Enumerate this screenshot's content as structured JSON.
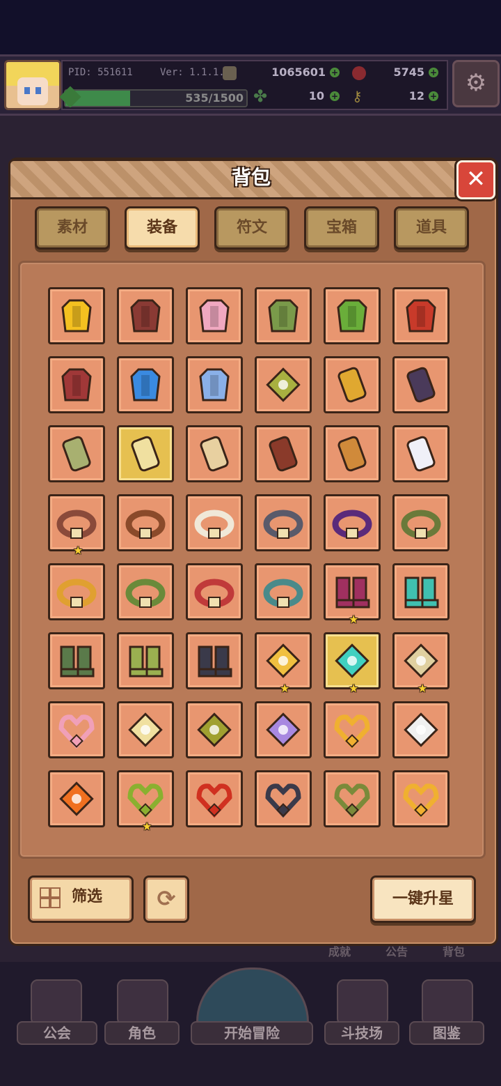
{
  "player": {
    "pid": "PID: 551611",
    "version": "Ver: 1.1.1.2",
    "gold": "1065601",
    "gems": "5745",
    "clover": "10",
    "keys": "12",
    "xp_text": "535/1500",
    "xp_progress": 0.357
  },
  "dialog": {
    "title": "背包",
    "close": "✕",
    "tabs": [
      {
        "label": "素材",
        "active": false
      },
      {
        "label": "装备",
        "active": true
      },
      {
        "label": "符文",
        "active": false
      },
      {
        "label": "宝箱",
        "active": false
      },
      {
        "label": "道具",
        "active": false
      }
    ],
    "filter_label": "筛选",
    "refresh_icon": "refresh-icon",
    "star_up_label": "一键升星"
  },
  "inventory": [
    {
      "icon": "gold-helmet",
      "color": "#f4c020",
      "starred": false,
      "gold_bg": false
    },
    {
      "icon": "dark-hood",
      "color": "#8a3a34",
      "starred": false,
      "gold_bg": false
    },
    {
      "icon": "pink-robe",
      "color": "#f0a8c0",
      "starred": false,
      "gold_bg": false
    },
    {
      "icon": "green-armor",
      "color": "#7a9a4a",
      "starred": false,
      "gold_bg": false
    },
    {
      "icon": "jade-armor",
      "color": "#6aae3a",
      "starred": false,
      "gold_bg": false
    },
    {
      "icon": "crimson-armor",
      "color": "#c83a2a",
      "starred": false,
      "gold_bg": false
    },
    {
      "icon": "demon-armor",
      "color": "#a03838",
      "starred": false,
      "gold_bg": false
    },
    {
      "icon": "sapphire-armor",
      "color": "#3a8ae0",
      "starred": false,
      "gold_bg": false
    },
    {
      "icon": "ghost-cloak",
      "color": "#8ab0e8",
      "starred": false,
      "gold_bg": false
    },
    {
      "icon": "leaf-bracer",
      "color": "#a8b040",
      "starred": false,
      "gold_bg": false
    },
    {
      "icon": "gold-bracer",
      "color": "#e0a830",
      "starred": false,
      "gold_bg": false
    },
    {
      "icon": "shadow-glove",
      "color": "#4a3a5a",
      "starred": false,
      "gold_bg": false
    },
    {
      "icon": "scale-gauntlet",
      "color": "#a8b070",
      "starred": false,
      "gold_bg": false
    },
    {
      "icon": "holy-gauntlet",
      "color": "#f0e0a0",
      "starred": false,
      "gold_bg": true
    },
    {
      "icon": "cloth-wrap",
      "color": "#e8d0a0",
      "starred": false,
      "gold_bg": false
    },
    {
      "icon": "fur-bracer",
      "color": "#8a3a2a",
      "starred": false,
      "gold_bg": false
    },
    {
      "icon": "striped-bracer",
      "color": "#d08a3a",
      "starred": false,
      "gold_bg": false
    },
    {
      "icon": "crystal-gauntlet",
      "color": "#f0f0f8",
      "starred": false,
      "gold_bg": false
    },
    {
      "icon": "winged-ring",
      "color": "#8a4a3a",
      "starred": true,
      "gold_bg": false
    },
    {
      "icon": "emerald-band",
      "color": "#8a4a2a",
      "starred": false,
      "gold_bg": false
    },
    {
      "icon": "pearl-belt",
      "color": "#f0e8d8",
      "starred": false,
      "gold_bg": false
    },
    {
      "icon": "iron-belt",
      "color": "#5a5a6a",
      "starred": false,
      "gold_bg": false
    },
    {
      "icon": "void-belt",
      "color": "#5a2a7a",
      "starred": false,
      "gold_bg": false
    },
    {
      "icon": "moss-belt",
      "color": "#6a7a3a",
      "starred": false,
      "gold_bg": false
    },
    {
      "icon": "gold-ring",
      "color": "#e0a030",
      "starred": false,
      "gold_bg": false
    },
    {
      "icon": "verdant-ring",
      "color": "#6a8a3a",
      "starred": false,
      "gold_bg": false
    },
    {
      "icon": "ruby-crown",
      "color": "#c03a3a",
      "starred": false,
      "gold_bg": false
    },
    {
      "icon": "teal-mask",
      "color": "#4a8a8a",
      "starred": false,
      "gold_bg": false
    },
    {
      "icon": "rune-boots",
      "color": "#a03060",
      "starred": true,
      "gold_bg": false
    },
    {
      "icon": "aqua-boots",
      "color": "#40c0b0",
      "starred": false,
      "gold_bg": false
    },
    {
      "icon": "moss-boots",
      "color": "#5a7a4a",
      "starred": false,
      "gold_bg": false
    },
    {
      "icon": "olive-boots",
      "color": "#9ab050",
      "starred": false,
      "gold_bg": false
    },
    {
      "icon": "night-boots",
      "color": "#3a3a4a",
      "starred": false,
      "gold_bg": false
    },
    {
      "icon": "sun-amulet",
      "color": "#f0c040",
      "starred": true,
      "gold_bg": false
    },
    {
      "icon": "aqua-gem",
      "color": "#40d0c0",
      "starred": true,
      "gold_bg": true
    },
    {
      "icon": "sword-emblem",
      "color": "#e0d0a0",
      "starred": true,
      "gold_bg": false
    },
    {
      "icon": "heart-shell",
      "color": "#f0a0b8",
      "starred": false,
      "gold_bg": false
    },
    {
      "icon": "rose-star",
      "color": "#f0e0a0",
      "starred": false,
      "gold_bg": false
    },
    {
      "icon": "jade-leaf",
      "color": "#a0a030",
      "starred": false,
      "gold_bg": false
    },
    {
      "icon": "amethyst-flower",
      "color": "#a888e0",
      "starred": false,
      "gold_bg": false
    },
    {
      "icon": "heart-tome",
      "color": "#f0b030",
      "starred": false,
      "gold_bg": false
    },
    {
      "icon": "holy-cross",
      "color": "#f0f0f0",
      "starred": false,
      "gold_bg": false
    },
    {
      "icon": "fire-rhombus",
      "color": "#f07020",
      "starred": false,
      "gold_bg": false
    },
    {
      "icon": "leaf-necklace",
      "color": "#8ab030",
      "starred": true,
      "gold_bg": false
    },
    {
      "icon": "flame-heart",
      "color": "#d03020",
      "starred": false,
      "gold_bg": false
    },
    {
      "icon": "obsidian-heart",
      "color": "#3a3a4a",
      "starred": false,
      "gold_bg": false
    },
    {
      "icon": "vine-necklace",
      "color": "#7a8a3a",
      "starred": false,
      "gold_bg": false
    },
    {
      "icon": "gold-heart",
      "color": "#f0b030",
      "starred": false,
      "gold_bg": false
    }
  ],
  "background": {
    "links": [
      "成就",
      "公告",
      "背包"
    ]
  },
  "nav": [
    {
      "label": "公会"
    },
    {
      "label": "角色"
    },
    {
      "label": "开始冒险"
    },
    {
      "label": "斗技场"
    },
    {
      "label": "图鉴"
    }
  ]
}
